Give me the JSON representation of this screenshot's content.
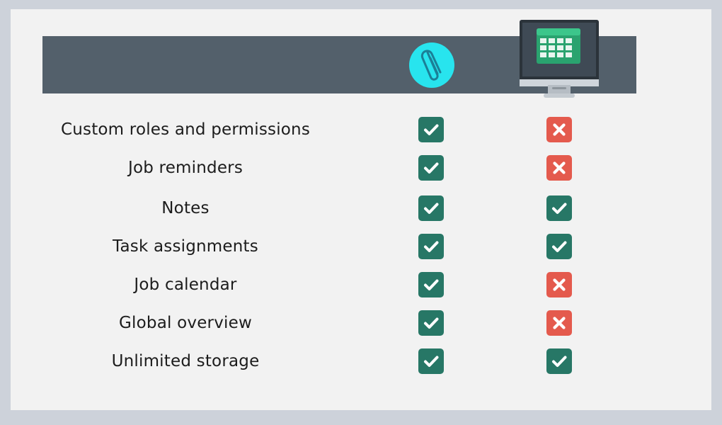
{
  "header": {
    "column_a_icon": "paperclip-logo-icon",
    "column_b_icon": "spreadsheet-monitor-icon"
  },
  "colors": {
    "header_band": "#53606b",
    "check_background": "#277766",
    "cross_background": "#e45a4d",
    "logo_circle": "#28e4ee"
  },
  "rows": [
    {
      "label": "Custom roles and permissions",
      "column_a": "check",
      "column_b": "cross"
    },
    {
      "label": "Job reminders",
      "column_a": "check",
      "column_b": "cross"
    },
    {
      "label": "Notes",
      "column_a": "check",
      "column_b": "check"
    },
    {
      "label": "Task assignments",
      "column_a": "check",
      "column_b": "check"
    },
    {
      "label": "Job calendar",
      "column_a": "check",
      "column_b": "cross"
    },
    {
      "label": "Global overview",
      "column_a": "check",
      "column_b": "cross"
    },
    {
      "label": "Unlimited storage",
      "column_a": "check",
      "column_b": "check"
    }
  ]
}
